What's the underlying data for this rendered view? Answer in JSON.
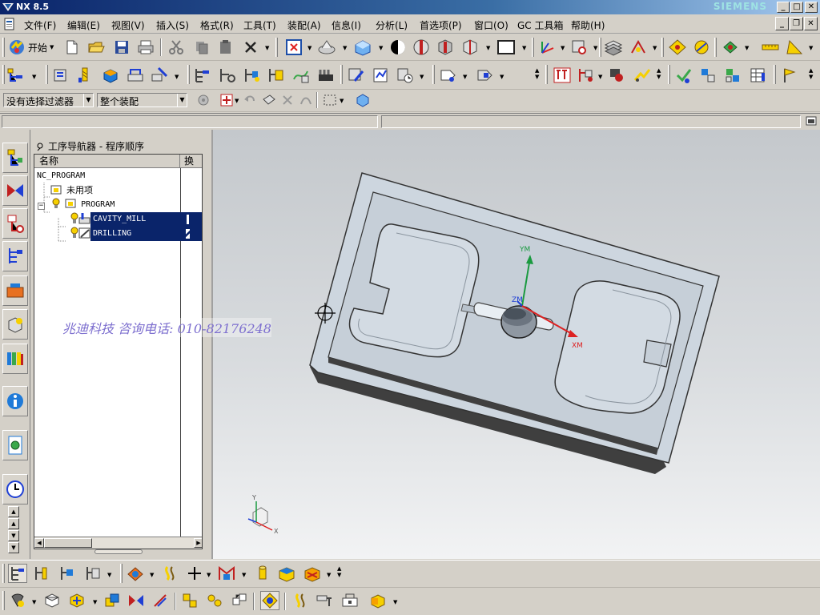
{
  "window": {
    "title": "NX 8.5",
    "brand": "SIEMENS",
    "controls": [
      "_",
      "□",
      "✕"
    ]
  },
  "menu": {
    "items": [
      "文件(F)",
      "编辑(E)",
      "视图(V)",
      "插入(S)",
      "格式(R)",
      "工具(T)",
      "装配(A)",
      "信息(I)",
      "分析(L)",
      "首选项(P)",
      "窗口(O)",
      "GC 工具箱",
      "帮助(H)"
    ]
  },
  "toolbar": {
    "start_label": "开始"
  },
  "selection": {
    "filter_value": "没有选择过滤器",
    "scope_value": "整个装配"
  },
  "navigator": {
    "title": "工序导航器 - 程序顺序",
    "col_name": "名称",
    "col_change": "换",
    "rows": [
      {
        "label": "NC_PROGRAM"
      },
      {
        "label": "未用项"
      },
      {
        "label": "PROGRAM"
      },
      {
        "label": "CAVITY_MILL"
      },
      {
        "label": "DRILLING"
      }
    ]
  },
  "graphics": {
    "axis_labels": {
      "ym": "YM",
      "zm": "ZM",
      "xm": "XM"
    },
    "triad_labels": {
      "y": "Y",
      "x": "X"
    },
    "watermark": "兆迪科技 咨询电话: 010-82176248"
  },
  "colors": {
    "title_gradient_start": "#0a246a",
    "selection_bg": "#0a246a",
    "part_face": "#cfd8e0",
    "axis_x": "#d22",
    "axis_y": "#1a9a40",
    "axis_z": "#1f3fd4",
    "watermark": "#7d6fcf"
  }
}
